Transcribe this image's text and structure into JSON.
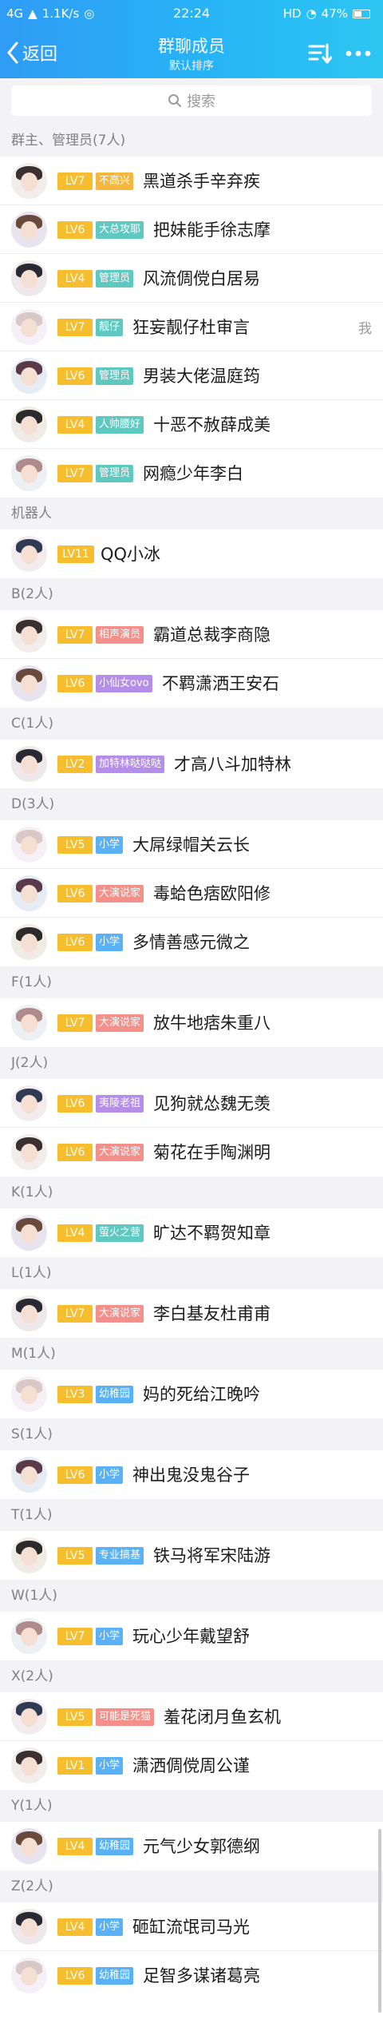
{
  "status_bar": {
    "network": "4G",
    "signal": "4G",
    "speed": "1.1K/s",
    "time": "22:24",
    "hd": "HD",
    "battery": "47%"
  },
  "nav": {
    "back_label": "返回",
    "title": "群聊成员",
    "subtitle": "默认排序"
  },
  "search": {
    "placeholder": "搜索"
  },
  "colors": {
    "accent": "#2eaaf5",
    "level": "#f6bd2e",
    "tag_admin": "#5fc8c1",
    "tag_owner": "#f6b83c",
    "tag_funny": "#f48f8a",
    "tag_cute": "#b48ee8",
    "tag_primary": "#5ab1f5"
  },
  "sections": [
    {
      "header": "群主、管理员(7人)",
      "members": [
        {
          "level": "LV7",
          "tag": "不高兴",
          "tag_color": "#f6b83c",
          "name": "黑道杀手辛弃疾"
        },
        {
          "level": "LV6",
          "tag": "大总攻耶",
          "tag_color": "#5fc8c1",
          "name": "把妹能手徐志摩"
        },
        {
          "level": "LV4",
          "tag": "管理员",
          "tag_color": "#5fc8c1",
          "name": "风流倜傥白居易"
        },
        {
          "level": "LV7",
          "tag": "靓仔",
          "tag_color": "#5fc8c1",
          "name": "狂妄靓仔杜审言",
          "me": "我"
        },
        {
          "level": "LV6",
          "tag": "管理员",
          "tag_color": "#5fc8c1",
          "name": "男装大佬温庭筠"
        },
        {
          "level": "LV4",
          "tag": "人帅腰好",
          "tag_color": "#5fc8c1",
          "name": "十恶不赦薛成美"
        },
        {
          "level": "LV7",
          "tag": "管理员",
          "tag_color": "#5fc8c1",
          "name": "网瘾少年李白"
        }
      ]
    },
    {
      "header": "机器人",
      "members": [
        {
          "level": "LV11",
          "tag": "",
          "tag_color": "",
          "name": "QQ小冰"
        }
      ]
    },
    {
      "header": "B(2人)",
      "members": [
        {
          "level": "LV7",
          "tag": "相声演员",
          "tag_color": "#f48f8a",
          "name": "霸道总裁李商隐"
        },
        {
          "level": "LV6",
          "tag": "小仙女ovo",
          "tag_color": "#b48ee8",
          "name": "不羁潇洒王安石"
        }
      ]
    },
    {
      "header": "C(1人)",
      "members": [
        {
          "level": "LV2",
          "tag": "加特林哒哒哒",
          "tag_color": "#b48ee8",
          "name": "才高八斗加特林"
        }
      ]
    },
    {
      "header": "D(3人)",
      "members": [
        {
          "level": "LV5",
          "tag": "小学",
          "tag_color": "#5ab1f5",
          "name": "大屌绿帽关云长"
        },
        {
          "level": "LV6",
          "tag": "大演说家",
          "tag_color": "#f48f8a",
          "name": "毒蛤色痞欧阳修"
        },
        {
          "level": "LV6",
          "tag": "小学",
          "tag_color": "#5ab1f5",
          "name": "多情善感元微之"
        }
      ]
    },
    {
      "header": "F(1人)",
      "members": [
        {
          "level": "LV7",
          "tag": "大演说家",
          "tag_color": "#f48f8a",
          "name": "放牛地痞朱重八"
        }
      ]
    },
    {
      "header": "J(2人)",
      "members": [
        {
          "level": "LV6",
          "tag": "夷陵老祖",
          "tag_color": "#b48ee8",
          "name": "见狗就怂魏无羡"
        },
        {
          "level": "LV6",
          "tag": "大演说家",
          "tag_color": "#f48f8a",
          "name": "菊花在手陶渊明"
        }
      ]
    },
    {
      "header": "K(1人)",
      "members": [
        {
          "level": "LV4",
          "tag": "萤火之营",
          "tag_color": "#5fc8c1",
          "name": "旷达不羁贺知章"
        }
      ]
    },
    {
      "header": "L(1人)",
      "members": [
        {
          "level": "LV7",
          "tag": "大演说家",
          "tag_color": "#f48f8a",
          "name": "李白基友杜甫甫"
        }
      ]
    },
    {
      "header": "M(1人)",
      "members": [
        {
          "level": "LV3",
          "tag": "幼稚园",
          "tag_color": "#5ab1f5",
          "name": "妈的死给江晚吟"
        }
      ]
    },
    {
      "header": "S(1人)",
      "members": [
        {
          "level": "LV6",
          "tag": "小学",
          "tag_color": "#5ab1f5",
          "name": "神出鬼没鬼谷子"
        }
      ]
    },
    {
      "header": "T(1人)",
      "members": [
        {
          "level": "LV5",
          "tag": "专业搞基",
          "tag_color": "#5ab1f5",
          "name": "铁马将军宋陆游"
        }
      ]
    },
    {
      "header": "W(1人)",
      "members": [
        {
          "level": "LV7",
          "tag": "小学",
          "tag_color": "#5ab1f5",
          "name": "玩心少年戴望舒"
        }
      ]
    },
    {
      "header": "X(2人)",
      "members": [
        {
          "level": "LV5",
          "tag": "可能是死猫",
          "tag_color": "#f48f8a",
          "name": "羞花闭月鱼玄机"
        },
        {
          "level": "LV1",
          "tag": "小学",
          "tag_color": "#5ab1f5",
          "name": "潇洒倜傥周公谨"
        }
      ]
    },
    {
      "header": "Y(1人)",
      "members": [
        {
          "level": "LV4",
          "tag": "幼稚园",
          "tag_color": "#5ab1f5",
          "name": "元气少女郭德纲"
        }
      ]
    },
    {
      "header": "Z(2人)",
      "members": [
        {
          "level": "LV4",
          "tag": "小学",
          "tag_color": "#5ab1f5",
          "name": "砸缸流氓司马光"
        },
        {
          "level": "LV6",
          "tag": "幼稚园",
          "tag_color": "#5ab1f5",
          "name": "足智多谋诸葛亮"
        }
      ]
    }
  ]
}
